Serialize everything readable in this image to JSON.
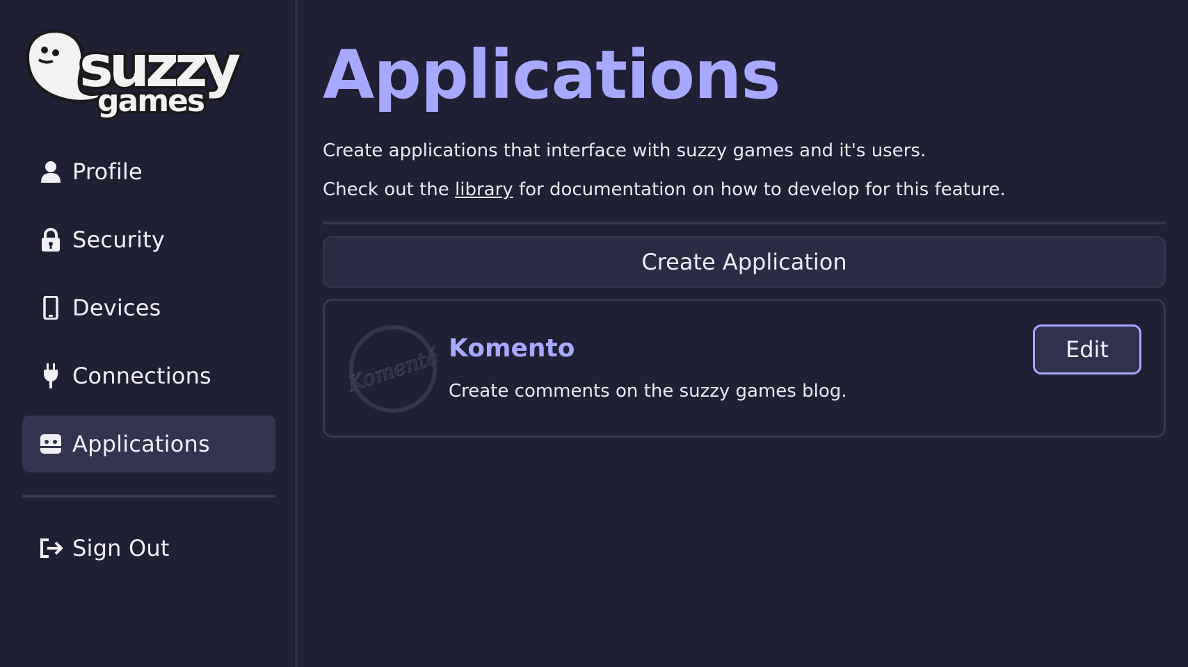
{
  "brand": {
    "logo_top": "suzzy",
    "logo_bottom": "games"
  },
  "sidebar": {
    "items": [
      {
        "label": "Profile",
        "icon": "person-icon"
      },
      {
        "label": "Security",
        "icon": "lock-icon"
      },
      {
        "label": "Devices",
        "icon": "phone-icon"
      },
      {
        "label": "Connections",
        "icon": "plug-icon"
      },
      {
        "label": "Applications",
        "icon": "robot-icon",
        "active": true
      }
    ],
    "sign_out": {
      "label": "Sign Out",
      "icon": "sign-out-icon"
    }
  },
  "main": {
    "title": "Applications",
    "description_line1": "Create applications that interface with suzzy games and it's users.",
    "description_line2_prefix": "Check out the ",
    "description_line2_link": "library",
    "description_line2_suffix": " for documentation on how to develop for this feature.",
    "create_button_label": "Create Application",
    "applications": [
      {
        "name": "Komento",
        "logo_text": "Komentó",
        "description": "Create comments on the suzzy games blog.",
        "edit_label": "Edit"
      }
    ]
  },
  "colors": {
    "background": "#202035",
    "accent": "#a7a8ff",
    "active_nav": "#33344f",
    "card_border": "#36374f"
  }
}
